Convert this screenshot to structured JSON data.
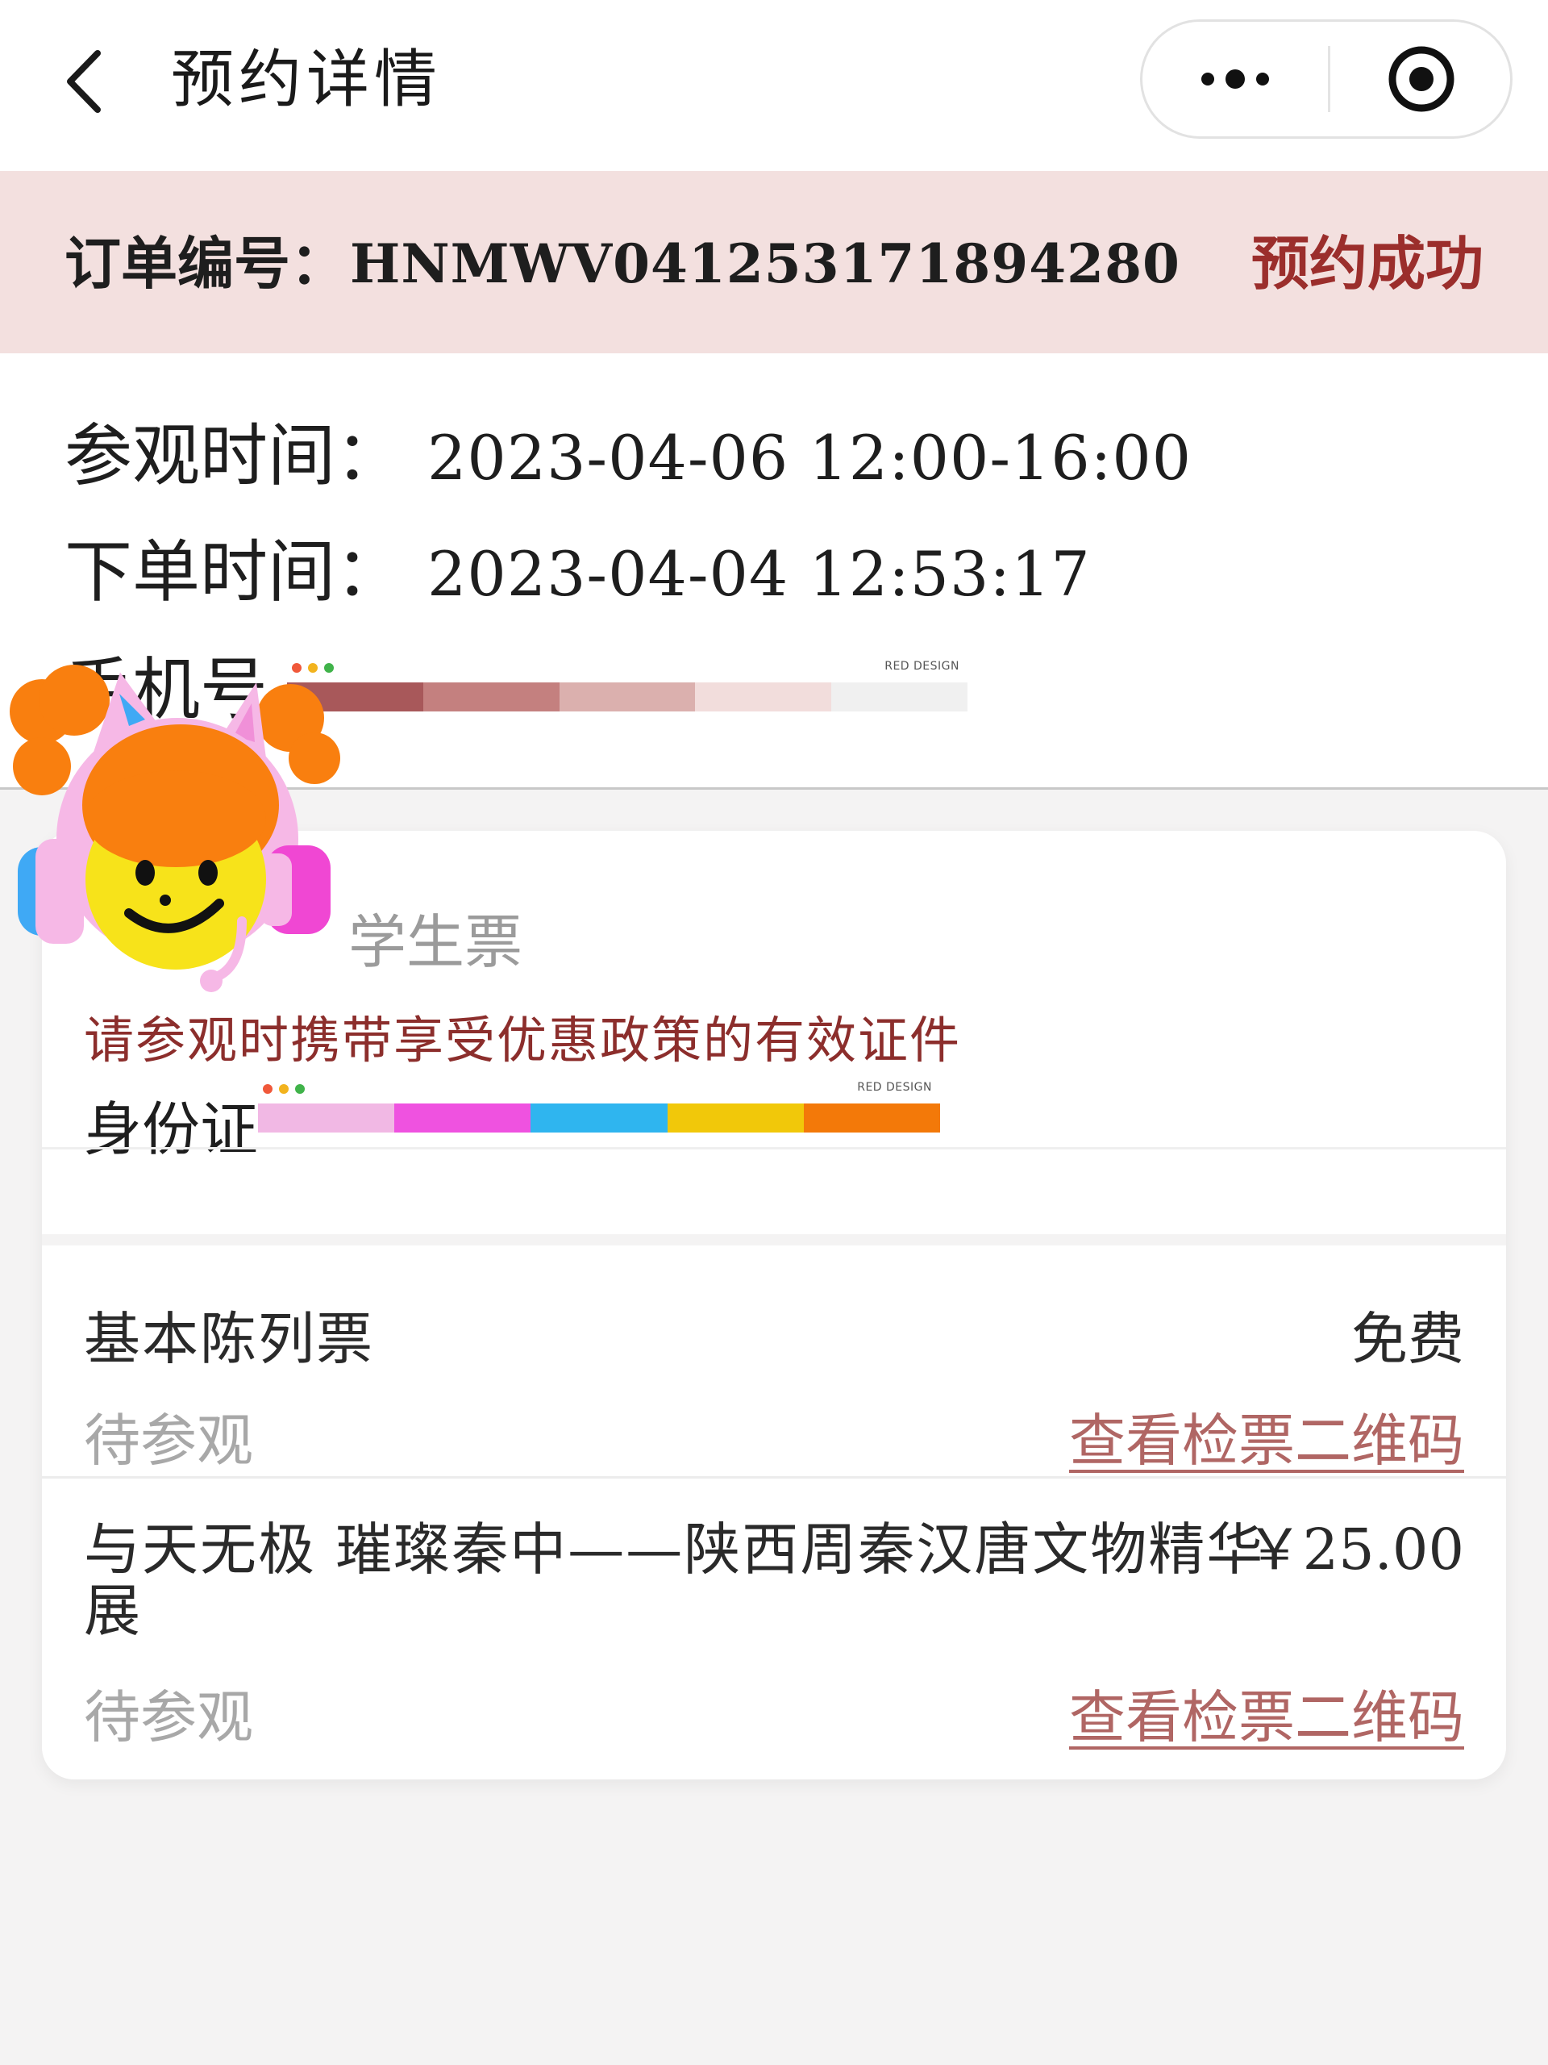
{
  "nav": {
    "title": "预约详情",
    "back_icon": "chevron-left-icon",
    "more_icon": "more-dots-icon",
    "close_icon": "target-circle-icon"
  },
  "order": {
    "label": "订单编号：",
    "number": "HNMWV041253171894280",
    "status": "预约成功"
  },
  "info": {
    "visit_label": "参观时间：",
    "visit_value": "2023-04-06 12:00-16:00",
    "order_time_label": "下单时间：",
    "order_time_value": "2023-04-04 12:53:17",
    "phone_label": "手机号"
  },
  "card": {
    "ticket_type": "学生票",
    "notice": "请参观时携带享受优惠政策的有效证件",
    "id_label": "身份证",
    "items": [
      {
        "name": "基本陈列票",
        "price": "免费",
        "status": "待参观",
        "link": "查看检票二维码"
      },
      {
        "name": "与天无极 璀璨秦中——陕西周秦汉唐文物精华展",
        "price": "￥25.00",
        "status": "待参观",
        "link": "查看检票二维码"
      }
    ]
  },
  "mask": {
    "brand": "RED DESIGN",
    "phone_colors": [
      "#a8585a",
      "#c4807f",
      "#dbb0ae",
      "#f2dddc",
      "#f0f0f0"
    ],
    "id_colors": [
      "#f1b8e4",
      "#ef52e0",
      "#2fb5ef",
      "#f1c80a",
      "#f37909"
    ],
    "dot_colors": [
      "#f0583a",
      "#f2b31e",
      "#40b34a"
    ]
  },
  "colors": {
    "accent": "#9b2e2c",
    "link": "#b06664",
    "order_bar": "#f3e0df"
  }
}
